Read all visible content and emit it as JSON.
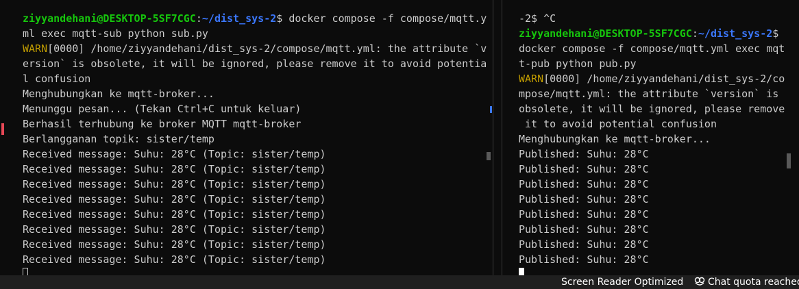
{
  "left_pane": {
    "lines": [
      [
        {
          "t": "  ",
          "c": "plain"
        }
      ],
      [
        {
          "t": "ziyyandehani@DESKTOP-5SF7CGC",
          "c": "user"
        },
        {
          "t": ":",
          "c": "plain"
        },
        {
          "t": "~/dist_sys-2",
          "c": "path"
        },
        {
          "t": "$ docker compose -f compose/mqtt.y",
          "c": "plain"
        }
      ],
      [
        {
          "t": "ml exec mqtt-sub python sub.py",
          "c": "plain"
        }
      ],
      [
        {
          "t": "WARN",
          "c": "warn"
        },
        {
          "t": "[0000] /home/ziyyandehani/dist_sys-2/compose/mqtt.yml: the attribute `v",
          "c": "plain"
        }
      ],
      [
        {
          "t": "ersion` is obsolete, it will be ignored, please remove it to avoid potentia",
          "c": "plain"
        }
      ],
      [
        {
          "t": "l confusion",
          "c": "plain"
        }
      ],
      [
        {
          "t": "Menghubungkan ke mqtt-broker...",
          "c": "plain"
        }
      ],
      [
        {
          "t": "Menunggu pesan... (Tekan Ctrl+C untuk keluar)",
          "c": "plain"
        }
      ],
      [
        {
          "t": "Berhasil terhubung ke broker MQTT mqtt-broker",
          "c": "plain"
        }
      ],
      [
        {
          "t": "Berlangganan topik: sister/temp",
          "c": "plain"
        }
      ],
      [
        {
          "t": "Received message: Suhu: 28°C (Topic: sister/temp)",
          "c": "plain"
        }
      ],
      [
        {
          "t": "Received message: Suhu: 28°C (Topic: sister/temp)",
          "c": "plain"
        }
      ],
      [
        {
          "t": "Received message: Suhu: 28°C (Topic: sister/temp)",
          "c": "plain"
        }
      ],
      [
        {
          "t": "Received message: Suhu: 28°C (Topic: sister/temp)",
          "c": "plain"
        }
      ],
      [
        {
          "t": "Received message: Suhu: 28°C (Topic: sister/temp)",
          "c": "plain"
        }
      ],
      [
        {
          "t": "Received message: Suhu: 28°C (Topic: sister/temp)",
          "c": "plain"
        }
      ],
      [
        {
          "t": "Received message: Suhu: 28°C (Topic: sister/temp)",
          "c": "plain"
        }
      ],
      [
        {
          "t": "Received message: Suhu: 28°C (Topic: sister/temp)",
          "c": "plain"
        }
      ]
    ]
  },
  "right_pane": {
    "lines": [
      [
        {
          "t": "  ",
          "c": "plain"
        }
      ],
      [
        {
          "t": "-2$ ^C",
          "c": "plain"
        }
      ],
      [
        {
          "t": "ziyyandehani@DESKTOP-5SF7CGC",
          "c": "user"
        },
        {
          "t": ":",
          "c": "plain"
        },
        {
          "t": "~/dist_sys-2",
          "c": "path"
        },
        {
          "t": "$",
          "c": "plain"
        }
      ],
      [
        {
          "t": "docker compose -f compose/mqtt.yml exec mqt",
          "c": "plain"
        }
      ],
      [
        {
          "t": "t-pub python pub.py",
          "c": "plain"
        }
      ],
      [
        {
          "t": "WARN",
          "c": "warn"
        },
        {
          "t": "[0000] /home/ziyyandehani/dist_sys-2/co",
          "c": "plain"
        }
      ],
      [
        {
          "t": "mpose/mqtt.yml: the attribute `version` is",
          "c": "plain"
        }
      ],
      [
        {
          "t": "obsolete, it will be ignored, please remove",
          "c": "plain"
        }
      ],
      [
        {
          "t": " it to avoid potential confusion",
          "c": "plain"
        }
      ],
      [
        {
          "t": "Menghubungkan ke mqtt-broker...",
          "c": "plain"
        }
      ],
      [
        {
          "t": "Published: Suhu: 28°C",
          "c": "plain"
        }
      ],
      [
        {
          "t": "Published: Suhu: 28°C",
          "c": "plain"
        }
      ],
      [
        {
          "t": "Published: Suhu: 28°C",
          "c": "plain"
        }
      ],
      [
        {
          "t": "Published: Suhu: 28°C",
          "c": "plain"
        }
      ],
      [
        {
          "t": "Published: Suhu: 28°C",
          "c": "plain"
        }
      ],
      [
        {
          "t": "Published: Suhu: 28°C",
          "c": "plain"
        }
      ],
      [
        {
          "t": "Published: Suhu: 28°C",
          "c": "plain"
        }
      ],
      [
        {
          "t": "Published: Suhu: 28°C",
          "c": "plain"
        }
      ]
    ]
  },
  "status_bar": {
    "reader_label": "Screen Reader Optimized",
    "quota_label": "Chat quota reached",
    "quota_icon": "copilot-icon"
  },
  "colors": {
    "background": "#0c0c0c",
    "foreground": "#cccccc",
    "user": "#16c60c",
    "path": "#3b78ff",
    "warn": "#c19c00"
  }
}
